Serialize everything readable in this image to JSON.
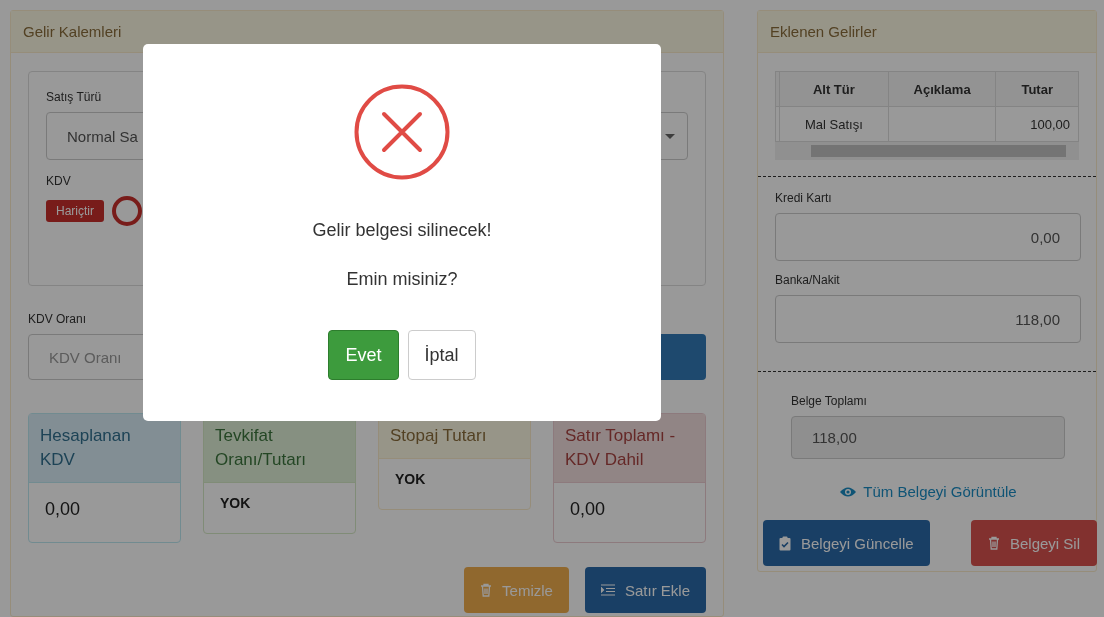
{
  "left_panel": {
    "title": "Gelir Kalemleri",
    "sale_type": {
      "label": "Satış Türü",
      "value": "Normal Sa"
    },
    "vat": {
      "label": "KDV",
      "badge": "Hariçtir"
    },
    "vat_rate": {
      "label": "KDV Oranı",
      "placeholder": "KDV Oranı"
    },
    "summary_cards": [
      {
        "kind": "info",
        "title": "Hesaplanan KDV",
        "value": "0,00"
      },
      {
        "kind": "success",
        "title": "Tevkifat Oranı/Tutarı",
        "value": "YOK"
      },
      {
        "kind": "warning",
        "title": "Stopaj Tutarı",
        "value": "YOK"
      },
      {
        "kind": "danger",
        "title": "Satır Toplamı - KDV Dahil",
        "value": "0,00"
      }
    ],
    "buttons": [
      {
        "kind": "warning",
        "label": "Temizle"
      },
      {
        "kind": "primary",
        "label": "Satır Ekle"
      }
    ]
  },
  "right_panel": {
    "title": "Eklenen Gelirler",
    "table": {
      "columns": [
        "Alt Tür",
        "Açıklama",
        "Tutar"
      ],
      "rows": [
        [
          "Mal Satışı",
          "",
          "100,00"
        ]
      ]
    },
    "credit_card": {
      "label": "Kredi Kartı",
      "value": "0,00"
    },
    "bank_cash": {
      "label": "Banka/Nakit",
      "value": "118,00"
    },
    "document_total": {
      "label": "Belge Toplamı",
      "value": "118,00",
      "disabled": true
    },
    "view_link": "Tüm Belgeyi Görüntüle",
    "buttons": [
      {
        "kind": "primary",
        "label": "Belgeyi Güncelle"
      },
      {
        "kind": "danger",
        "label": "Belgeyi Sil"
      }
    ]
  },
  "dialog": {
    "title": "Gelir belgesi silinecek!",
    "text": "Emin misiniz?",
    "buttons": [
      {
        "kind": "confirm",
        "label": "Evet"
      },
      {
        "kind": "cancel",
        "label": "İptal"
      }
    ]
  }
}
